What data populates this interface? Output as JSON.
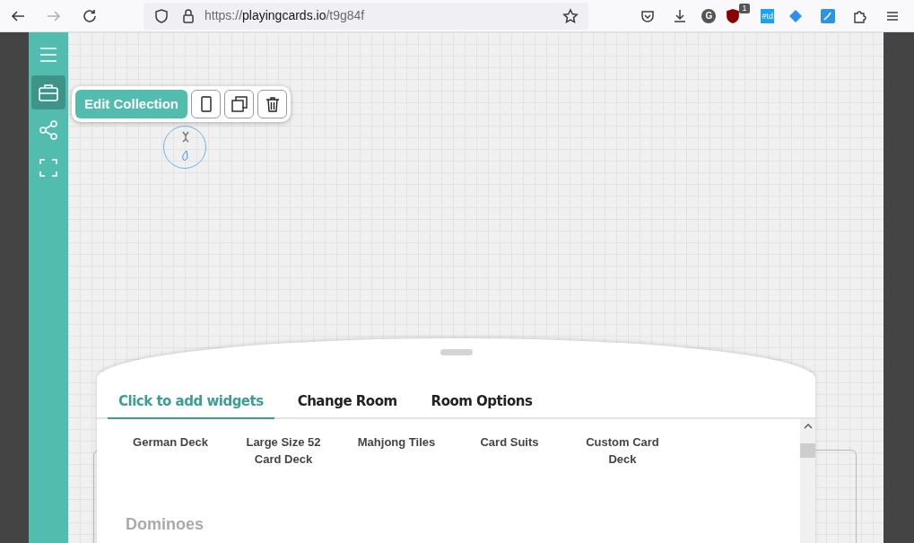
{
  "browser": {
    "url": {
      "scheme": "https://",
      "domain": "playingcards.io",
      "path": "/t9g84f"
    },
    "forward_disabled": true,
    "extension_badge": "1",
    "extension_tag": "#td",
    "avatar_letter": "G"
  },
  "sidebar": {
    "items": [
      {
        "kind": "menu",
        "selected": false
      },
      {
        "kind": "briefcase",
        "selected": true
      },
      {
        "kind": "share",
        "selected": false
      },
      {
        "kind": "fullscreen",
        "selected": false
      }
    ]
  },
  "toolbar": {
    "edit_button": "Edit Collection"
  },
  "panel": {
    "tabs": [
      {
        "label": "Click to add widgets",
        "selected": true
      },
      {
        "label": "Change Room",
        "selected": false
      },
      {
        "label": "Room Options",
        "selected": false
      }
    ],
    "widgets": [
      {
        "label": "German Deck"
      },
      {
        "label": "Large Size 52 Card Deck"
      },
      {
        "label": "Mahjong Tiles"
      },
      {
        "label": "Card Suits"
      },
      {
        "label": "Custom Card Deck"
      }
    ],
    "section": "Dominoes"
  }
}
